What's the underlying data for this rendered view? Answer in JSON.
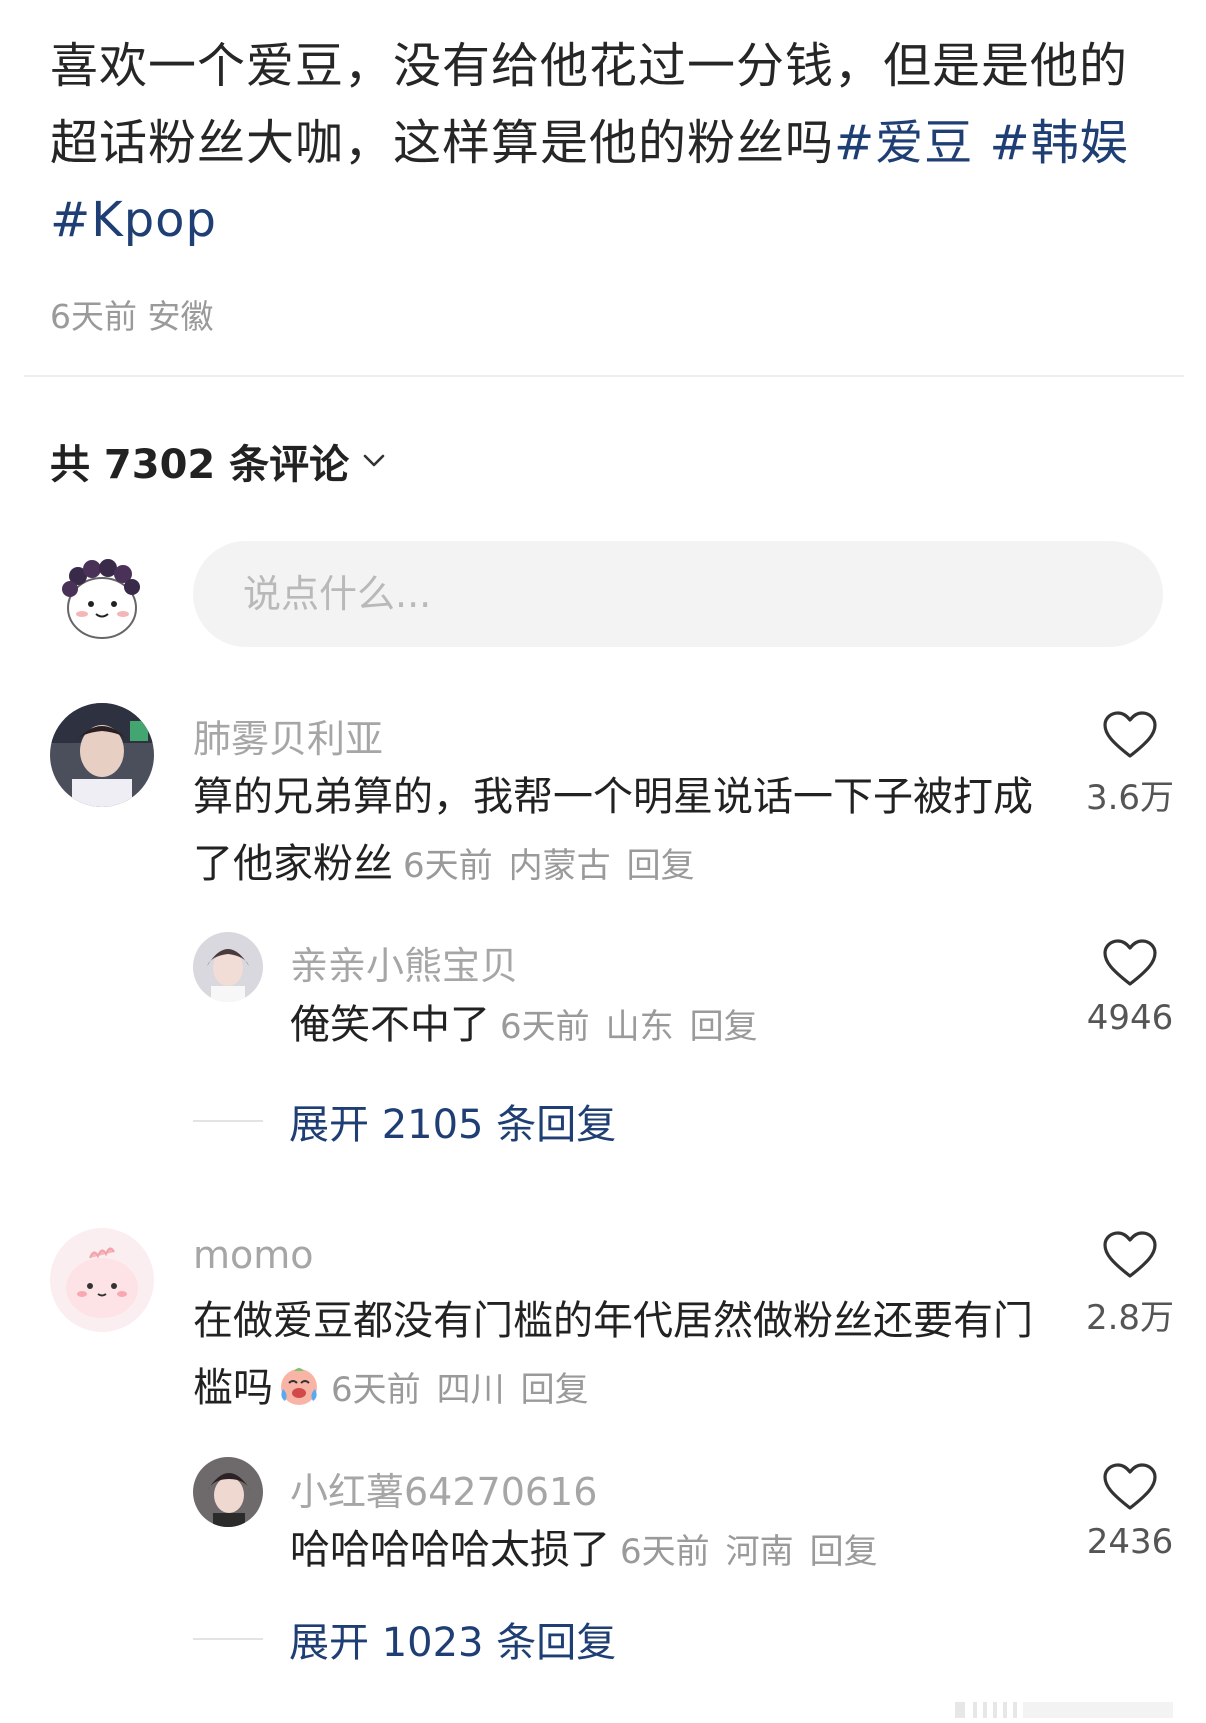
{
  "post": {
    "text": "喜欢一个爱豆，没有给他花过一分钱，但是是他的超话粉丝大咖，这样算是他的粉丝吗",
    "tags": [
      "#爱豆",
      "#韩娱",
      "#Kpop"
    ],
    "time": "6天前",
    "location": "安徽"
  },
  "comments_header": {
    "label": "共 7302 条评论"
  },
  "input": {
    "placeholder": "说点什么..."
  },
  "comments": [
    {
      "username": "肺雾贝利亚",
      "text": "算的兄弟算的，我帮一个明星说话一下子被打成了他家粉丝",
      "time": "6天前",
      "location": "内蒙古",
      "reply": "回复",
      "likes": "3.6万",
      "sub": {
        "username": "亲亲小熊宝贝",
        "text": "俺笑不中了",
        "time": "6天前",
        "location": "山东",
        "reply": "回复",
        "likes": "4946"
      },
      "expand": "展开 2105 条回复"
    },
    {
      "username": "momo",
      "text": "在做爱豆都没有门槛的年代居然做粉丝还要有门槛吗",
      "time": "6天前",
      "location": "四川",
      "reply": "回复",
      "likes": "2.8万",
      "sub": {
        "username": "小红薯64270616",
        "text": "哈哈哈哈哈太损了",
        "time": "6天前",
        "location": "河南",
        "reply": "回复",
        "likes": "2436"
      },
      "expand": "展开 1023 条回复"
    }
  ],
  "icons": {
    "like": "heart-outline-icon",
    "chevron": "chevron-down-icon"
  },
  "colors": {
    "tag": "#1f3f74",
    "meta": "#9a9a9a",
    "input_bg": "#f3f3f3"
  }
}
